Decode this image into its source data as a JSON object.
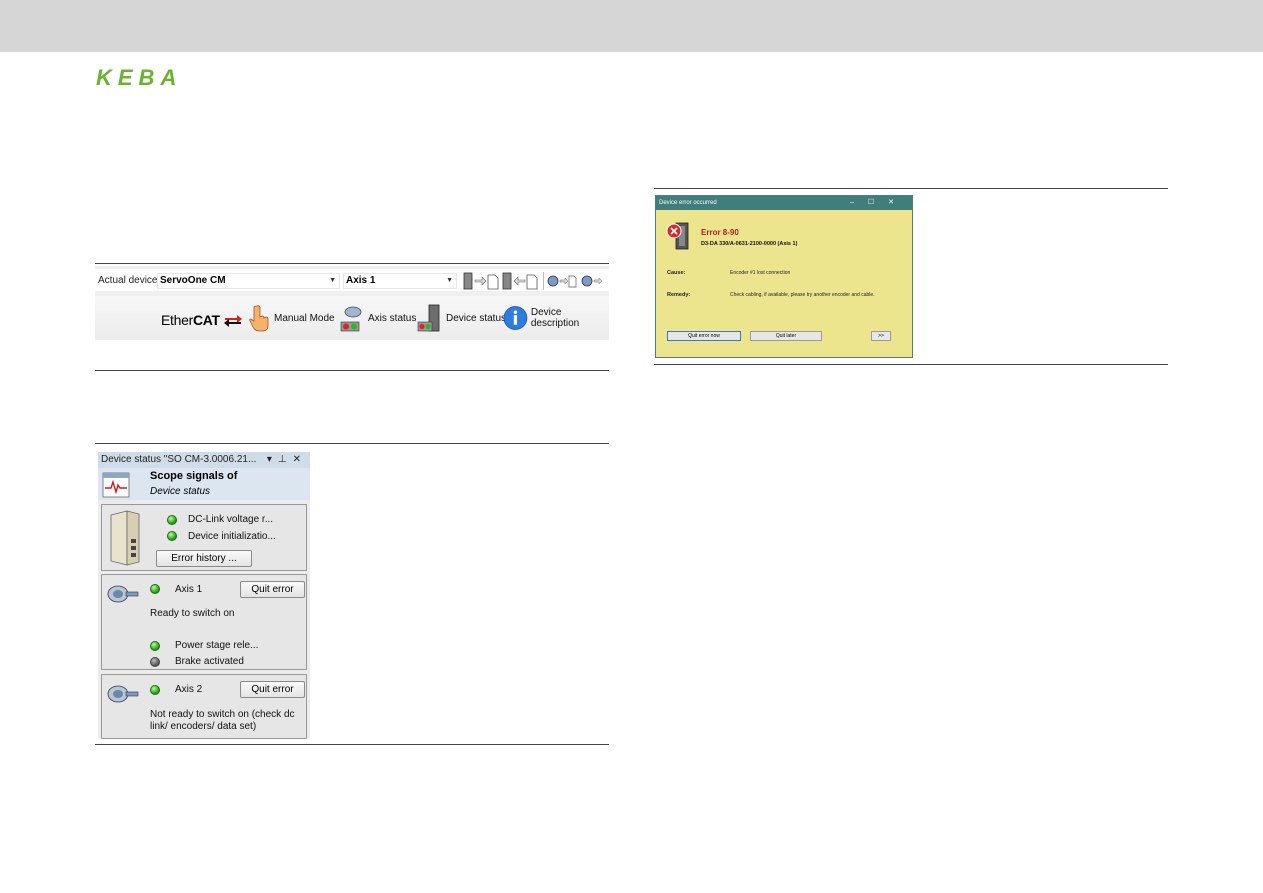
{
  "logo": {
    "text": "KEBA",
    "color": "#6bb32e"
  },
  "toolbar": {
    "actual_device_label": "Actual device:",
    "device_value": "ServoOne CM",
    "axis_value": "Axis 1",
    "ethercat_prefix": "Ether",
    "ethercat_suffix": "CAT",
    "buttons": {
      "manual_mode": "Manual Mode",
      "axis_status": "Axis status",
      "device_status": "Device status",
      "device_description": "Device description"
    }
  },
  "device_status": {
    "title": "Device status \"SO CM-3.0006.21...",
    "scope_title": "Scope signals of",
    "scope_subtitle": "Device status",
    "device_box": {
      "items": [
        "DC-Link voltage r...",
        "Device initializatio..."
      ],
      "error_history_button": "Error history ..."
    },
    "axis1": {
      "label": "Axis 1",
      "quit_button": "Quit error",
      "state": "Ready to switch on",
      "items": [
        "Power stage rele...",
        "Brake activated"
      ]
    },
    "axis2": {
      "label": "Axis 2",
      "quit_button": "Quit error",
      "state_line1": "Not ready to switch on (check dc",
      "state_line2": "link/ encoders/ data set)"
    }
  },
  "error_dialog": {
    "title": "Device error occurred",
    "error_code": "Error 8-90",
    "device": "D3-DA 330/A-0631-2100-0000 (Axis 1)",
    "cause_label": "Cause:",
    "cause_text": "Encoder #1 lost connection",
    "remedy_label": "Remedy:",
    "remedy_text": "Check cabling, if available, please try another encoder and cable.",
    "buttons": {
      "quit_now": "Quit error now",
      "quit_later": "Quit later",
      "more": ">>"
    },
    "colors": {
      "titlebar": "#3f7e7a",
      "body": "#ece58e",
      "error_text": "#b21f1f"
    }
  }
}
